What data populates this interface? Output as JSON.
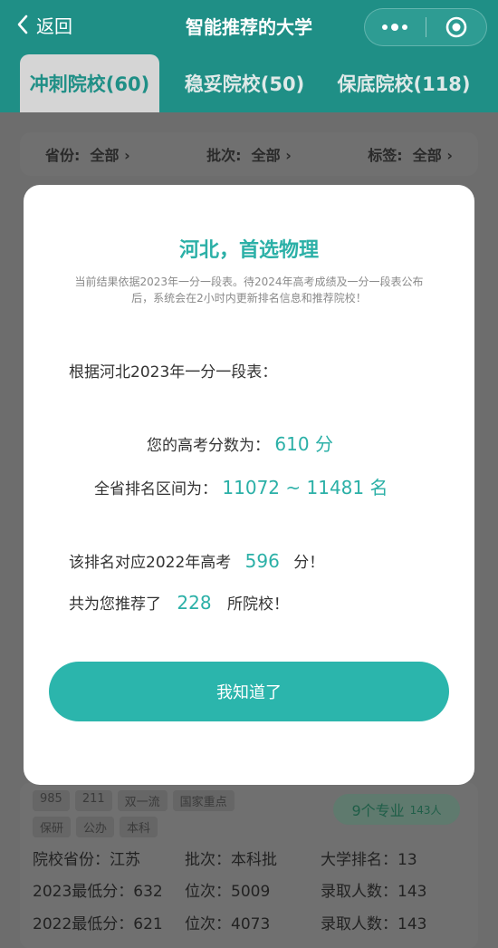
{
  "header": {
    "back_label": "返回",
    "title": "智能推荐的大学"
  },
  "tabs": [
    {
      "label": "冲刺院校(60)"
    },
    {
      "label": "稳妥院校(50)"
    },
    {
      "label": "保底院校(118)"
    }
  ],
  "filters": [
    {
      "label": "省份:",
      "value": "全部"
    },
    {
      "label": "批次:",
      "value": "全部"
    },
    {
      "label": "标签:",
      "value": "全部"
    }
  ],
  "card": {
    "tags": [
      "985",
      "211",
      "双一流",
      "国家重点",
      "保研",
      "公办",
      "本科"
    ],
    "major_count": "9个专业",
    "major_people": "143人",
    "rows": [
      [
        "院校省份：江苏",
        "批次：本科批",
        "大学排名：13"
      ],
      [
        "2023最低分：632",
        "位次：5009",
        "录取人数：143"
      ],
      [
        "2022最低分：621",
        "位次：4073",
        "录取人数：143"
      ]
    ]
  },
  "modal": {
    "title": "河北，首选物理",
    "note": "当前结果依据2023年一分一段表。待2024年高考成绩及一分一段表公布后，系统会在2小时内更新排名信息和推荐院校！",
    "basis": "根据河北2023年一分一段表：",
    "score_prefix": "您的高考分数为：",
    "score_value": "610 分",
    "rank_prefix": "全省排名区间为：",
    "rank_value": "11072 ~ 11481 名",
    "equiv_prefix": "该排名对应2022年高考",
    "equiv_value": "596",
    "equiv_suffix": "分！",
    "recommend_prefix": "共为您推荐了",
    "recommend_value": "228",
    "recommend_suffix": "所院校！",
    "confirm_label": "我知道了"
  },
  "colors": {
    "accent": "#2bb0a7",
    "header": "#1f8f86"
  }
}
